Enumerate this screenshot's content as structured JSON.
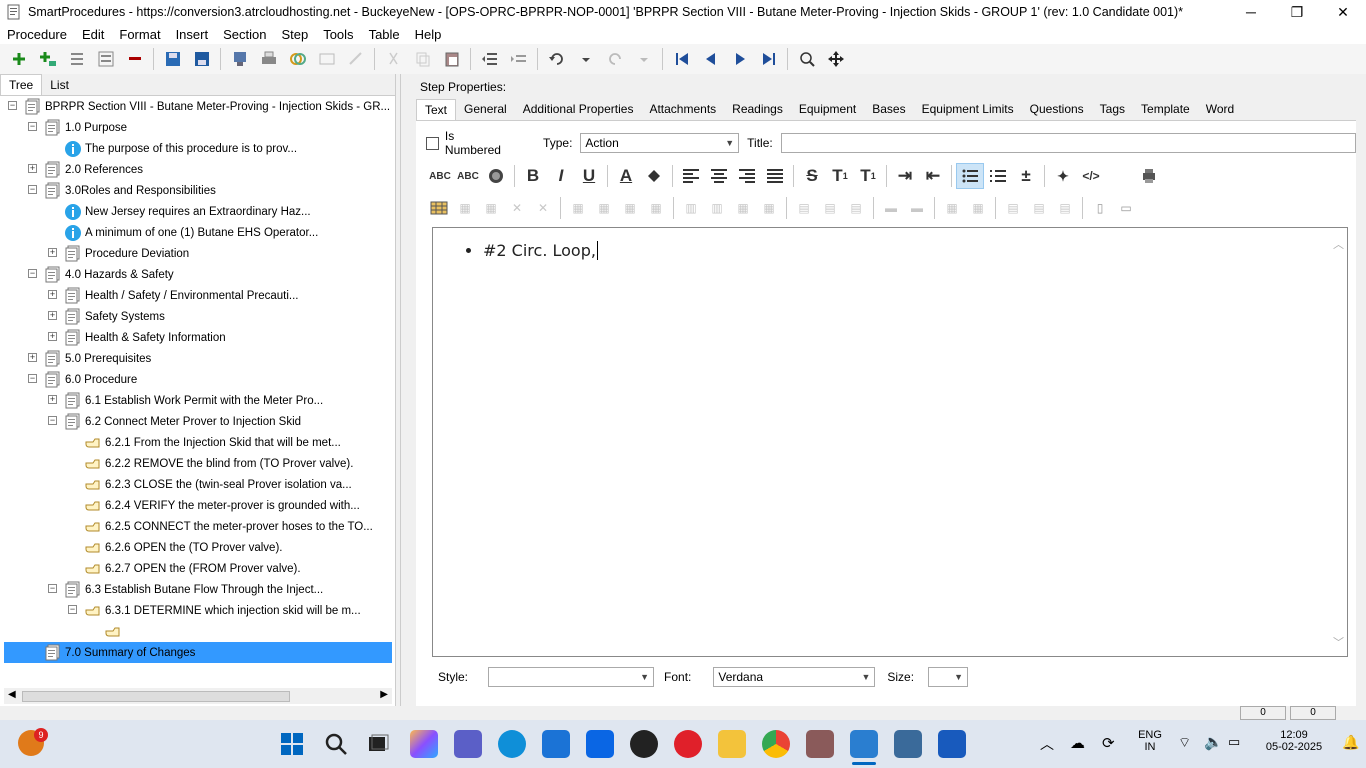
{
  "window": {
    "title": "SmartProcedures - https://conversion3.atrcloudhosting.net - BuckeyeNew - [OPS-OPRC-BPRPR-NOP-0001] 'BPRPR Section VIII - Butane Meter-Proving - Injection Skids - GROUP 1' (rev: 1.0 Candidate 001)*",
    "minimize": "─",
    "restore": "❐",
    "close": "✕"
  },
  "menu": [
    "Procedure",
    "Edit",
    "Format",
    "Insert",
    "Section",
    "Step",
    "Tools",
    "Table",
    "Help"
  ],
  "left_tabs": [
    "Tree",
    "List"
  ],
  "tree": [
    {
      "label": "BPRPR Section VIII - Butane Meter-Proving - Injection Skids - GR...",
      "icon": "document-icon",
      "exp": "−"
    },
    {
      "label": "1.0 Purpose",
      "icon": "document-icon",
      "exp": "−"
    },
    {
      "label": "The purpose of this procedure is to prov...",
      "icon": "info-icon",
      "exp": ""
    },
    {
      "label": "2.0 References",
      "icon": "document-icon",
      "exp": "+"
    },
    {
      "label": "3.0Roles and Responsibilities",
      "icon": "document-icon",
      "exp": "−"
    },
    {
      "label": "New Jersey requires an Extraordinary Haz...",
      "icon": "info-icon",
      "exp": ""
    },
    {
      "label": "A minimum of one (1) Butane EHS Operator...",
      "icon": "info-icon",
      "exp": ""
    },
    {
      "label": "Procedure Deviation",
      "icon": "document-icon",
      "exp": "+"
    },
    {
      "label": "4.0 Hazards & Safety",
      "icon": "document-icon",
      "exp": "−"
    },
    {
      "label": "Health / Safety / Environmental Precauti...",
      "icon": "document-icon",
      "exp": "+"
    },
    {
      "label": "Safety Systems",
      "icon": "document-icon",
      "exp": "+"
    },
    {
      "label": "Health & Safety Information",
      "icon": "document-icon",
      "exp": "+"
    },
    {
      "label": "5.0 Prerequisites",
      "icon": "document-icon",
      "exp": "+"
    },
    {
      "label": "6.0 Procedure",
      "icon": "document-icon",
      "exp": "−"
    },
    {
      "label": "6.1 Establish Work Permit with the Meter Pro...",
      "icon": "document-icon",
      "exp": "+"
    },
    {
      "label": "6.2 Connect Meter Prover to Injection Skid",
      "icon": "document-icon",
      "exp": "−"
    },
    {
      "label": "6.2.1 From the Injection Skid that will be met...",
      "icon": "hand-icon",
      "exp": ""
    },
    {
      "label": "6.2.2 REMOVE the blind from (TO Prover valve).",
      "icon": "hand-icon",
      "exp": ""
    },
    {
      "label": "6.2.3 CLOSE the (twin-seal Prover isolation va...",
      "icon": "hand-icon",
      "exp": ""
    },
    {
      "label": "6.2.4 VERIFY the meter-prover is grounded with...",
      "icon": "hand-icon",
      "exp": ""
    },
    {
      "label": "6.2.5 CONNECT the meter-prover hoses to the TO...",
      "icon": "hand-icon",
      "exp": ""
    },
    {
      "label": "6.2.6 OPEN the (TO Prover valve).",
      "icon": "hand-icon",
      "exp": ""
    },
    {
      "label": "6.2.7 OPEN the (FROM Prover valve).",
      "icon": "hand-icon",
      "exp": ""
    },
    {
      "label": "6.3 Establish Butane Flow Through the Inject...",
      "icon": "document-icon",
      "exp": "−"
    },
    {
      "label": "6.3.1 DETERMINE which injection skid will be m...",
      "icon": "hand-icon",
      "exp": "−"
    },
    {
      "label": "",
      "icon": "hand-icon",
      "exp": ""
    },
    {
      "label": "7.0 Summary of Changes",
      "icon": "document-icon",
      "exp": ""
    }
  ],
  "step_properties": {
    "heading": "Step Properties:",
    "tabs": [
      "Text",
      "General",
      "Additional Properties",
      "Attachments",
      "Readings",
      "Equipment",
      "Bases",
      "Equipment Limits",
      "Questions",
      "Tags",
      "Template",
      "Word"
    ],
    "is_numbered_label": "Is Numbered",
    "type_label": "Type:",
    "type_value": "Action",
    "title_label": "Title:",
    "title_value": "",
    "editor_text": "#2 Circ. Loop,",
    "style_label": "Style:",
    "style_value": "",
    "font_label": "Font:",
    "font_value": "Verdana",
    "size_label": "Size:",
    "size_value": ""
  },
  "status": {
    "val1": "0",
    "val2": "0"
  },
  "taskbar": {
    "notif_count": "9",
    "lang_line1": "ENG",
    "lang_line2": "IN",
    "time": "12:09",
    "date": "05-02-2025"
  },
  "colors": {
    "selection": "#3399ff",
    "accent": "#0067c0"
  }
}
